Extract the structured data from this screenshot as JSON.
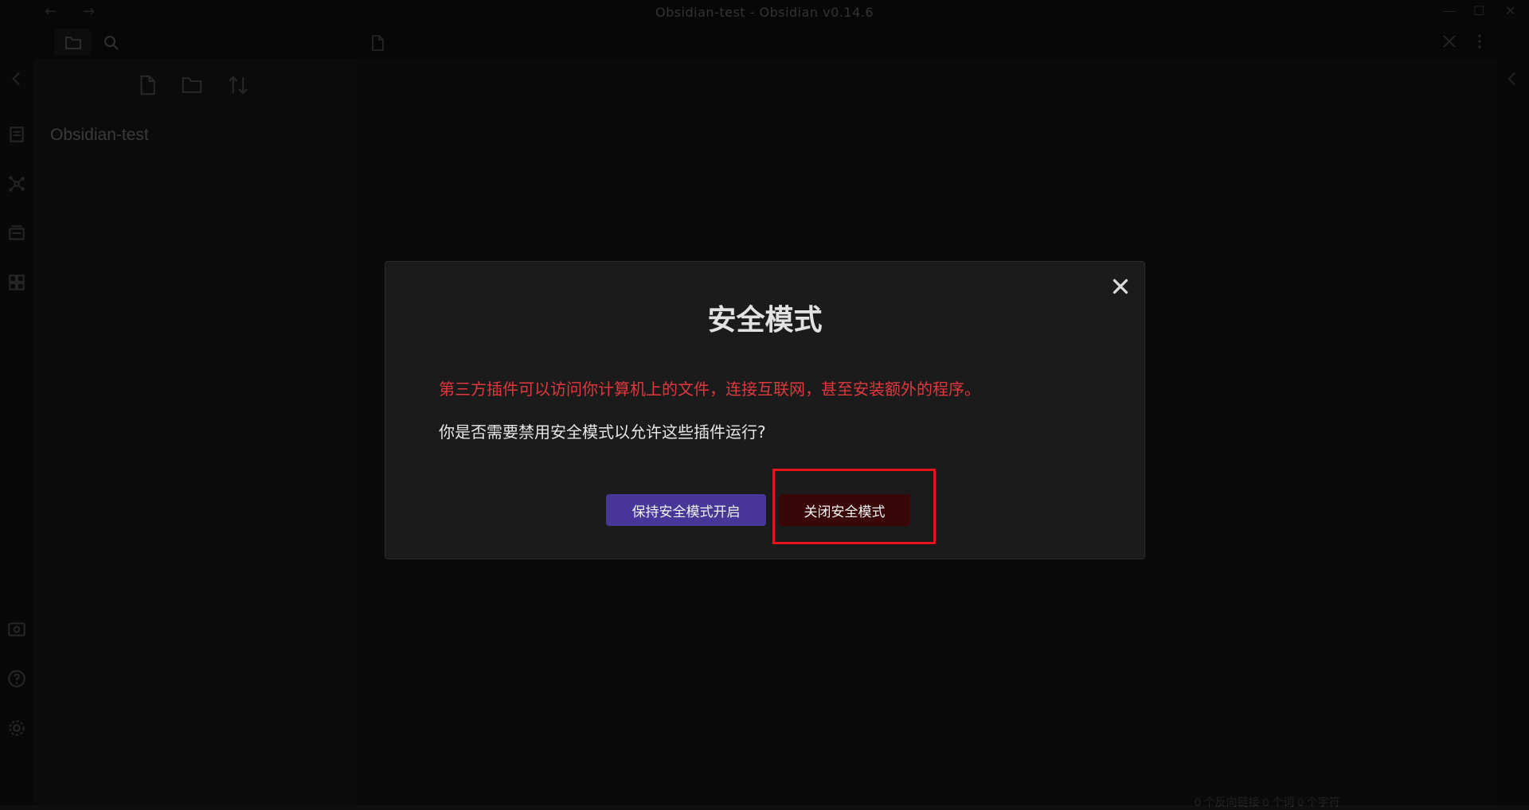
{
  "window": {
    "title": "Obsidian-test - Obsidian v0.14.6",
    "back_icon": "arrow-left-icon",
    "forward_icon": "arrow-right-icon",
    "minimize_glyph": "—",
    "maximize_glyph": "☐",
    "close_glyph": "✕"
  },
  "ribbon": {
    "items": [
      "collapse-left-icon",
      "daily-note-icon",
      "graph-view-icon",
      "canvas-icon",
      "plugins-icon",
      "vault-switcher-icon",
      "help-icon",
      "settings-icon"
    ]
  },
  "sidebar": {
    "tabs": [
      "file-explorer-icon",
      "search-icon"
    ],
    "actions": [
      "new-note-icon",
      "new-folder-icon",
      "sort-icon"
    ],
    "vault_name": "Obsidian-test"
  },
  "main": {
    "tab_icon": "file-icon",
    "close_icon": "close-icon",
    "more_icon": "more-options-icon"
  },
  "statusbar": {
    "text": "0 个反向链接    0 个词    0 个字符"
  },
  "modal": {
    "title": "安全模式",
    "warning": "第三方插件可以访问你计算机上的文件，连接互联网，甚至安装额外的程序。",
    "question": "你是否需要禁用安全模式以允许这些插件运行?",
    "keep_button": "保持安全模式开启",
    "disable_button": "关闭安全模式",
    "close_glyph": "✕"
  },
  "colors": {
    "accent": "#483699",
    "warning": "#e0383e",
    "danger_button": "#3a0708",
    "highlight": "#e8141c"
  }
}
